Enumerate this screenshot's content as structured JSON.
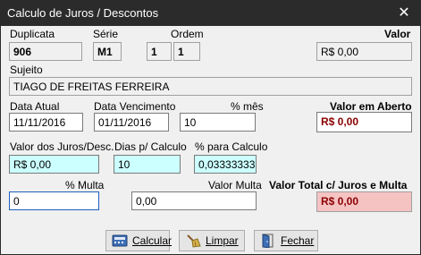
{
  "window": {
    "title": "Calculo de Juros / Descontos",
    "close_glyph": "✕"
  },
  "labels": {
    "duplicata": "Duplicata",
    "serie": "Série",
    "ordem": "Ordem",
    "valor": "Valor",
    "sujeito": "Sujeito",
    "data_atual": "Data Atual",
    "data_vencimento": "Data Vencimento",
    "pct_mes": "% mês",
    "valor_em_aberto": "Valor em Aberto",
    "valor_juros_desc": "Valor dos Juros/Desc.",
    "dias_calculo": "Dias p/ Calculo",
    "pct_calculo": "% para Calculo",
    "pct_multa": "% Multa",
    "valor_multa": "Valor Multa",
    "valor_total": "Valor Total c/ Juros e Multa"
  },
  "fields": {
    "duplicata": "906",
    "serie": "M1",
    "ordem_1": "1",
    "ordem_2": "1",
    "valor": "R$ 0,00",
    "sujeito": "TIAGO DE FREITAS FERREIRA",
    "data_atual": "11/11/2016",
    "data_vencimento": "01/11/2016",
    "pct_mes": "10",
    "valor_em_aberto": "R$ 0,00",
    "valor_juros_desc": "R$ 0,00",
    "dias_calculo": "10",
    "pct_calculo": "0,033333333",
    "pct_multa": "0",
    "valor_multa": "0,00",
    "valor_total": "R$ 0,00"
  },
  "buttons": {
    "calcular": "Calcular",
    "limpar": "Limpar",
    "fechar": "Fechar"
  },
  "colors": {
    "titlebar": "#2b2b2b",
    "cyan_field": "#ccffff",
    "total_field": "#f6c3c3",
    "money_text": "#8b0000"
  }
}
